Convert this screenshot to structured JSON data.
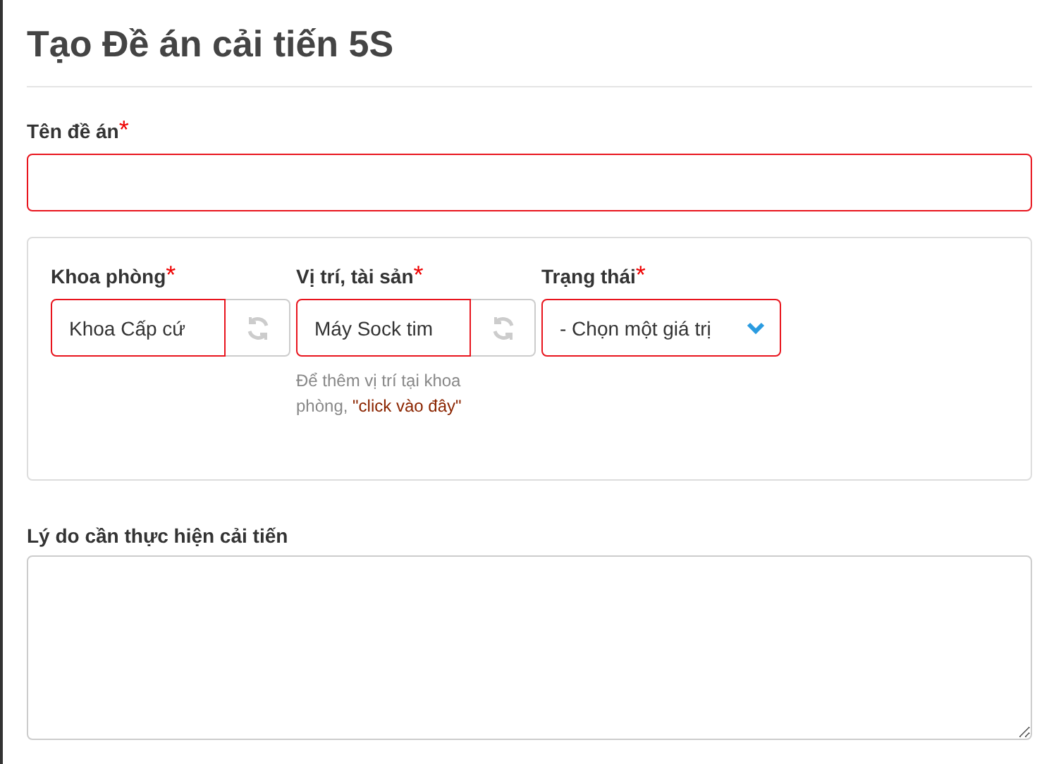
{
  "title": "Tạo Đề án cải tiến 5S",
  "name_field": {
    "label": "Tên đề án",
    "required_mark": "*",
    "invalid": true
  },
  "panel_fields": [
    {
      "kind": "lookup",
      "label": "Khoa phòng",
      "required_mark": "*",
      "invalid": true,
      "value": "Khoa Cấp cứ"
    },
    {
      "kind": "lookup",
      "label": "Vị trí, tài sản",
      "required_mark": "*",
      "invalid": true,
      "value": "Máy Sock tim",
      "help": "Để thêm vị trí tại khoa phòng, ",
      "help_link": "\"click vào đây\""
    },
    {
      "kind": "select",
      "label": "Trạng thái",
      "required_mark": "*",
      "invalid": true,
      "value": "- Chọn một giá trị"
    }
  ],
  "reason_field": {
    "label": "Lý do cần thực hiện cải tiến",
    "invalid": false
  }
}
